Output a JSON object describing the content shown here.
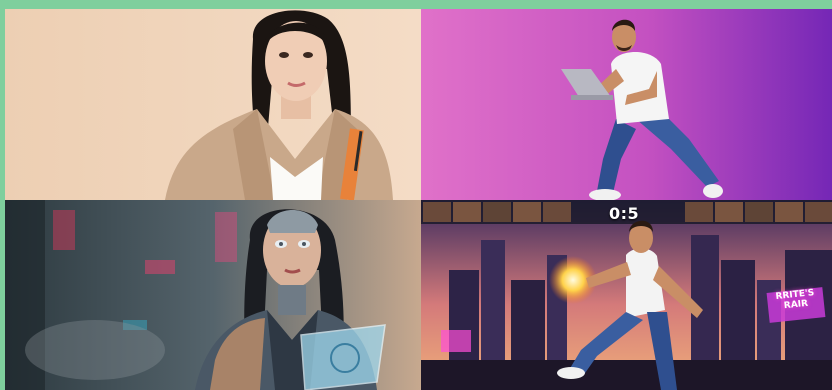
{
  "grid": {
    "tiles": [
      {
        "id": "top-left",
        "subject": "woman-in-beige-blazer-photo"
      },
      {
        "id": "top-right",
        "subject": "man-running-with-laptop-photo"
      },
      {
        "id": "bottom-left",
        "subject": "cyborg-woman-illustration"
      },
      {
        "id": "bottom-right",
        "subject": "fighting-game-scene-illustration"
      }
    ]
  },
  "game_hud": {
    "score": "0:5",
    "billboard_text": "RRITE'S\nRAIR"
  },
  "colors": {
    "frame_green": "#7fcf9d",
    "beige_backdrop": "#f1d6bd",
    "pink_backdrop": "#d15cc2",
    "purple_backdrop": "#7a2bb8"
  }
}
